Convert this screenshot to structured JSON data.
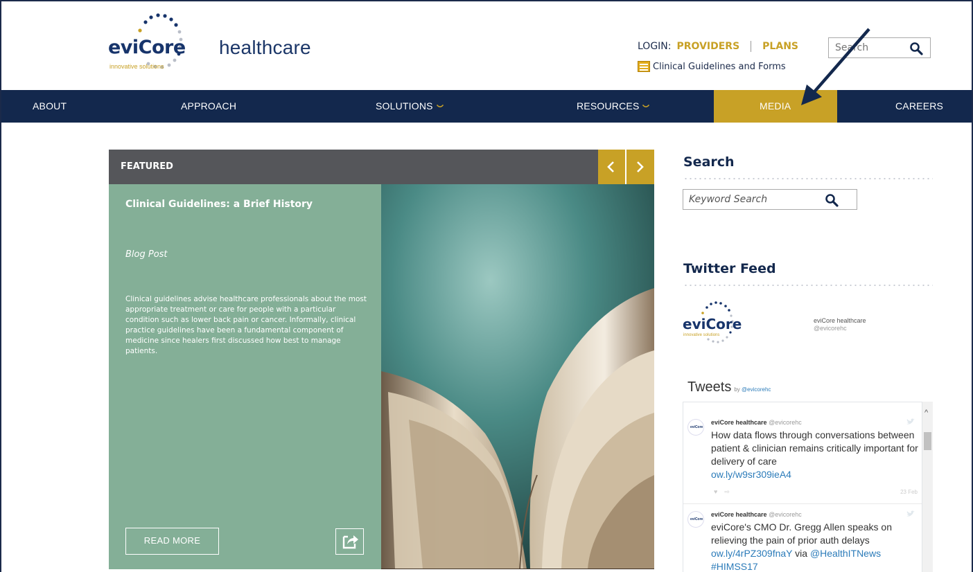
{
  "brand": {
    "wordmark": "eviCore",
    "suffix": "healthcare",
    "tagline": "innovative solutions"
  },
  "header": {
    "login_label": "LOGIN:",
    "providers_label": "PROVIDERS",
    "plans_label": "PLANS",
    "guidelines_label": "Clinical Guidelines and Forms",
    "search_placeholder": "Search",
    "search_icon": "search-icon",
    "guidelines_icon": "list-icon"
  },
  "nav": {
    "items": [
      {
        "label": "ABOUT"
      },
      {
        "label": "APPROACH"
      },
      {
        "label": "SOLUTIONS"
      },
      {
        "label": "RESOURCES"
      },
      {
        "label": "MEDIA",
        "active": true
      },
      {
        "label": "CAREERS"
      }
    ]
  },
  "featured": {
    "header": "FEATURED",
    "title": "Clinical Guidelines: a Brief History",
    "type": "Blog Post",
    "description": "Clinical guidelines advise healthcare professionals about the most appropriate treatment or care for people with a particular condition such as lower back pain or cancer. Informally, clinical practice guidelines have been a fundamental component of medicine since healers first discussed how best to manage patients.",
    "read_more": "READ MORE",
    "prev_icon": "chevron-left-icon",
    "next_icon": "chevron-right-icon",
    "share_icon": "share-icon"
  },
  "sidebar": {
    "search_heading": "Search",
    "keyword_placeholder": "Keyword Search",
    "twitter_heading": "Twitter Feed",
    "account_name": "eviCore healthcare",
    "account_handle": "@evicorehc",
    "tweets_title": "Tweets",
    "tweets_by": "by",
    "tweets_handle": "@evicorehc",
    "tweets": [
      {
        "name": "eviCore healthcare",
        "handle": "@evicorehc",
        "text": "How data flows through conversations between patient & clinician remains critically important for delivery of care",
        "link": "ow.ly/w9sr309ieA4",
        "date": "23 Feb"
      },
      {
        "name": "eviCore healthcare",
        "handle": "@evicorehc",
        "text": "eviCore's CMO Dr. Gregg Allen speaks on relieving the pain of prior auth delays",
        "link": "ow.ly/4rPZ309fnaY",
        "via": "via",
        "mention": "@HealthITNews",
        "hashtag": "#HIMSS17"
      }
    ]
  },
  "colors": {
    "navy": "#13284d",
    "gold": "#c8a126",
    "green_panel": "#84af97",
    "featured_bar": "#55565a"
  }
}
